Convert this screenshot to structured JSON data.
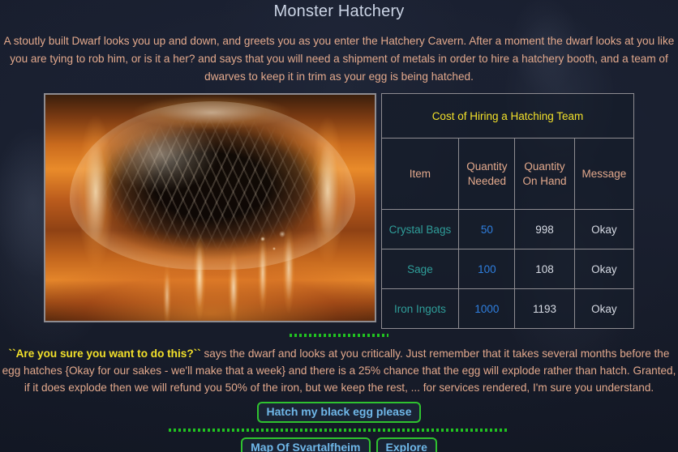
{
  "page": {
    "title": "Monster Hatchery"
  },
  "intro": {
    "text": "A stoutly built Dwarf looks you up and down, and greets you as you enter the Hatchery Cavern. After a moment the dwarf looks at you like you are tying to rob him, or is it a her? and says that you will need a shipment of metals in order to hire a hatchery booth, and a team of dwarves to keep it in trim as your egg is being hatched."
  },
  "artwork": {
    "alt": "black dragon egg engulfed in flames"
  },
  "table": {
    "title": "Cost of Hiring a Hatching Team",
    "headers": [
      "Item",
      "Quantity Needed",
      "Quantity On Hand",
      "Message"
    ],
    "headers_wrapped": [
      {
        "line1": "Item",
        "line2": ""
      },
      {
        "line1": "Quantity",
        "line2": "Needed"
      },
      {
        "line1": "Quantity",
        "line2": "On Hand"
      },
      {
        "line1": "Message",
        "line2": ""
      }
    ],
    "rows": [
      {
        "item": "Crystal Bags",
        "needed": "50",
        "on_hand": "998",
        "message": "Okay"
      },
      {
        "item": "Sage",
        "needed": "100",
        "on_hand": "108",
        "message": "Okay"
      },
      {
        "item": "Iron Ingots",
        "needed": "1000",
        "on_hand": "1193",
        "message": "Okay"
      }
    ]
  },
  "warning": {
    "quote": "``Are you sure you want to do this?``",
    "rest": " says the dwarf and looks at you critically. Just remember that it takes several months before the egg hatches {Okay for our sakes - we'll make that a week} and there is a 25% chance that the egg will explode rather than hatch. Granted, if it does explode then we will refund you 50% of the iron, but we keep the rest, ... for services rendered, I'm sure you understand."
  },
  "actions": {
    "hatch": "Hatch my black egg please",
    "map": "Map Of Svartalfheim",
    "explore": "Explore"
  },
  "colors": {
    "accent_yellow": "#f2e02a",
    "body_salmon": "#e3a98c",
    "title_blue": "#ccd5e6",
    "link_teal": "#2f9e9a",
    "needed_blue": "#2f7fe0",
    "button_border_green": "#2fc22f",
    "button_text_blue": "#6fb7e8",
    "divider_green": "#21c321",
    "page_bg": "#161b29"
  }
}
